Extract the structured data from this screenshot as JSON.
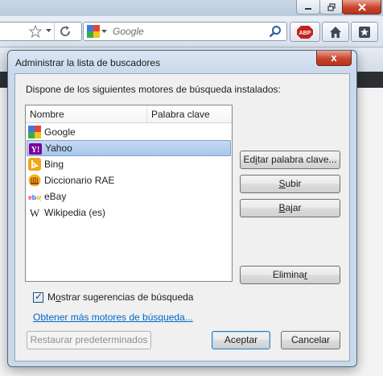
{
  "browser": {
    "search_placeholder": "Google"
  },
  "dialog": {
    "title": "Administrar la lista de buscadores",
    "intro": "Dispone de los siguientes motores de búsqueda instalados:",
    "columns": {
      "name": "Nombre",
      "keyword": "Palabra clave"
    },
    "engines": [
      {
        "name": "Google",
        "icon": "google-icon",
        "selected": false
      },
      {
        "name": "Yahoo",
        "icon": "yahoo-icon",
        "selected": true
      },
      {
        "name": "Bing",
        "icon": "bing-icon",
        "selected": false
      },
      {
        "name": "Diccionario RAE",
        "icon": "rae-icon",
        "selected": false
      },
      {
        "name": "eBay",
        "icon": "ebay-icon",
        "selected": false
      },
      {
        "name": "Wikipedia (es)",
        "icon": "wikipedia-icon",
        "selected": false
      }
    ],
    "buttons": {
      "edit_keyword": {
        "pre": "Ed",
        "acc": "i",
        "post": "tar palabra clave..."
      },
      "up": {
        "pre": "",
        "acc": "S",
        "post": "ubir"
      },
      "down": {
        "pre": "",
        "acc": "B",
        "post": "ajar"
      },
      "remove": {
        "pre": "Elimina",
        "acc": "r",
        "post": ""
      },
      "restore": "Restaurar predeterminados",
      "accept": "Aceptar",
      "cancel": "Cancelar"
    },
    "suggestions": {
      "pre": "M",
      "acc": "o",
      "post": "strar sugerencias de búsqueda",
      "checked": true
    },
    "more_engines_link": "Obtener más motores de búsqueda...",
    "close_symbol": "x"
  }
}
